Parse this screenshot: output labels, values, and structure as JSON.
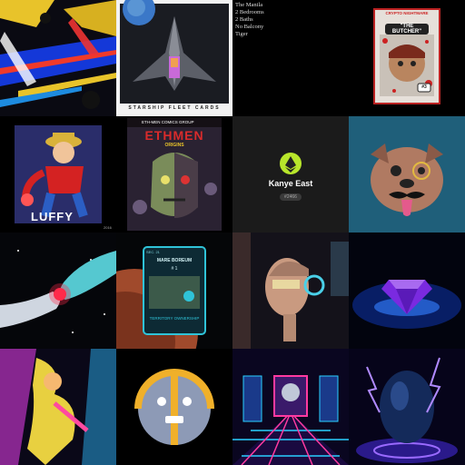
{
  "tiles": [
    {
      "name": "abstract-glitch-art"
    },
    {
      "name": "starship-fleet-cards",
      "caption": "STARSHIP FLEET CARDS"
    },
    {
      "name": "property-listing",
      "lines": [
        "The Manila",
        "2 Bedrooms",
        "2 Baths",
        "No Balcony",
        "Tiger"
      ]
    },
    {
      "name": "the-butcher-card",
      "header_top": "CRYPTO NIGHTMARE",
      "title": "\"THE BUTCHER\"",
      "badge": "#3"
    },
    {
      "name": "luffy-poster",
      "title": "LUFFY",
      "corner": "2016"
    },
    {
      "name": "eth-men-comic",
      "header": "ETH-MEN COMICS GROUP",
      "title": "ETHMEN",
      "subtitle": "ORIGINS"
    },
    {
      "name": "kanye-east-card",
      "title": "Kanye East",
      "id": "#2466"
    },
    {
      "name": "pitbull-mustache"
    },
    {
      "name": "hands-in-space"
    },
    {
      "name": "mars-territory-card",
      "corner_label": "SEC. 21",
      "region": "MARE BOREUM",
      "number": "# 1",
      "footer": "TERRITORY OWNERSHIP"
    },
    {
      "name": "cyber-robot-head"
    },
    {
      "name": "purple-diamond"
    },
    {
      "name": "neon-character"
    },
    {
      "name": "robot-ball"
    },
    {
      "name": "neon-arcade"
    },
    {
      "name": "lightning-egg"
    }
  ]
}
